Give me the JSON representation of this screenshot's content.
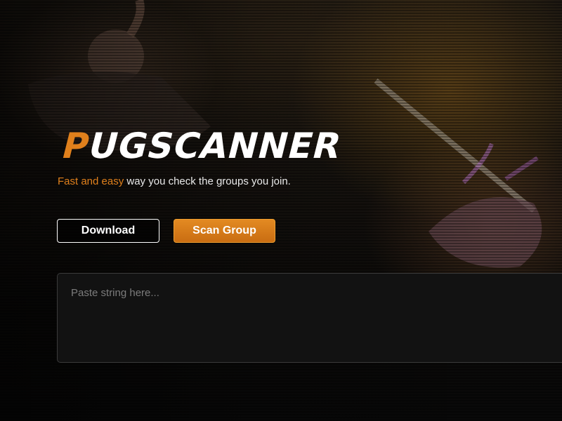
{
  "brand": {
    "logo_accent": "P",
    "logo_rest": "UGSCANNER",
    "accent_color": "#e0801c"
  },
  "hero": {
    "tagline_accent": "Fast and easy",
    "tagline_rest": " way you check the groups you join."
  },
  "actions": {
    "download_label": "Download",
    "scan_label": "Scan Group"
  },
  "input": {
    "placeholder": "Paste string here...",
    "value": ""
  }
}
